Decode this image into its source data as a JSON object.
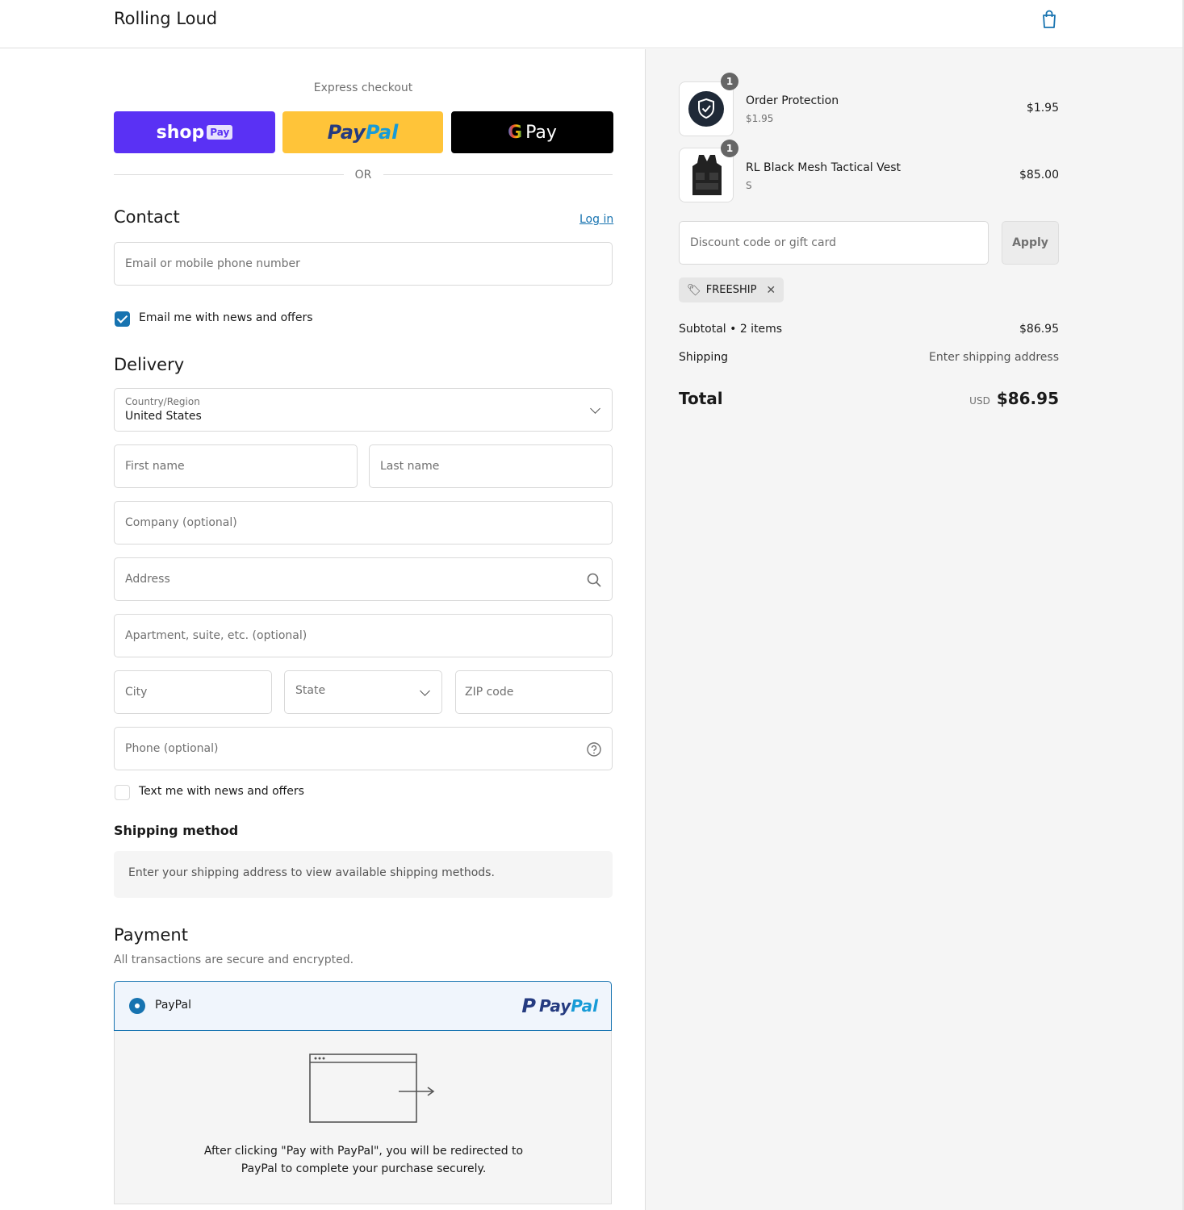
{
  "header": {
    "brand": "Rolling Loud",
    "cart_icon": "shopping-bag-icon"
  },
  "express": {
    "label": "Express checkout",
    "shop_pay": {
      "text": "shop",
      "badge": "Pay"
    },
    "paypal": {
      "part1": "Pay",
      "part2": "Pal"
    },
    "gpay": {
      "g": "G",
      "text": "Pay"
    },
    "or": "OR"
  },
  "contact": {
    "title": "Contact",
    "login": "Log in",
    "email_placeholder": "Email or mobile phone number",
    "newsletter": "Email me with news and offers",
    "newsletter_checked": true
  },
  "delivery": {
    "title": "Delivery",
    "country_label": "Country/Region",
    "country_value": "United States",
    "first_name": "First name",
    "last_name": "Last name",
    "company": "Company (optional)",
    "address": "Address",
    "apartment": "Apartment, suite, etc. (optional)",
    "city": "City",
    "state": "State",
    "zip": "ZIP code",
    "phone": "Phone (optional)",
    "sms": "Text me with news and offers",
    "sms_checked": false
  },
  "shipping_method": {
    "title": "Shipping method",
    "message": "Enter your shipping address to view available shipping methods."
  },
  "payment": {
    "title": "Payment",
    "subtitle": "All transactions are secure and encrypted.",
    "option_label": "PayPal",
    "logo_part1": "Pay",
    "logo_part2": "Pal",
    "message_line1": "After clicking \"Pay with PayPal\", you will be redirected to",
    "message_line2": "PayPal to complete your purchase securely."
  },
  "summary": {
    "items": [
      {
        "name": "Order Protection",
        "sub": "$1.95",
        "price": "$1.95",
        "qty": "1"
      },
      {
        "name": "RL Black Mesh Tactical Vest",
        "sub": "S",
        "price": "$85.00",
        "qty": "1"
      }
    ],
    "discount_placeholder": "Discount code or gift card",
    "apply": "Apply",
    "code": "FREESHIP",
    "subtotal_label": "Subtotal • 2 items",
    "subtotal_value": "$86.95",
    "shipping_label": "Shipping",
    "shipping_value": "Enter shipping address",
    "total_label": "Total",
    "currency": "USD",
    "total_value": "$86.95"
  },
  "colors": {
    "accent": "#1773b0",
    "shop_pay": "#5a31f4",
    "paypal": "#ffc439",
    "gpay": "#000000"
  }
}
